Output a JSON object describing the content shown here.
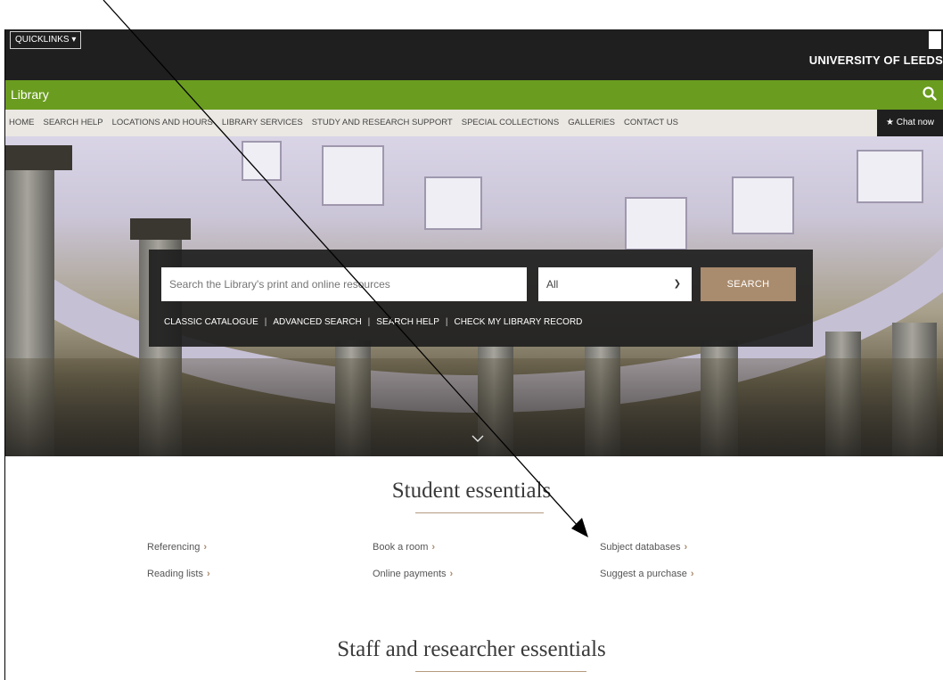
{
  "header": {
    "quicklinks_label": "QUICKLINKS ▾",
    "university_name": "UNIVERSITY OF LEEDS"
  },
  "library_bar": {
    "title": "Library",
    "search_icon": "search-icon",
    "color": "#6a9c1f"
  },
  "nav": {
    "items": [
      "HOME",
      "SEARCH HELP",
      "LOCATIONS AND HOURS",
      "LIBRARY SERVICES",
      "STUDY AND RESEARCH SUPPORT",
      "SPECIAL COLLECTIONS",
      "GALLERIES",
      "CONTACT US"
    ],
    "chat_label": "★ Chat now"
  },
  "search": {
    "placeholder": "Search the Library's print and online resources",
    "scope_value": "All",
    "button_label": "SEARCH",
    "button_color": "#a98b6d",
    "links": [
      "CLASSIC CATALOGUE",
      "ADVANCED SEARCH",
      "SEARCH HELP",
      "CHECK MY LIBRARY RECORD"
    ]
  },
  "student_essentials": {
    "title": "Student essentials",
    "links": [
      "Referencing",
      "Reading lists",
      "Book a room",
      "Online payments",
      "Subject databases",
      "Suggest a purchase"
    ]
  },
  "staff_essentials": {
    "title": "Staff and researcher essentials"
  }
}
